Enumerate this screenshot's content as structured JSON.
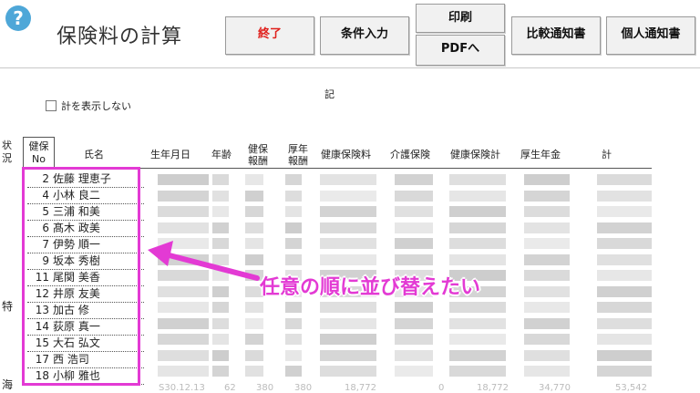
{
  "window": {
    "title": "保険料の計算",
    "help_icon": "question-circle-icon",
    "help_label": "?"
  },
  "toolbar": {
    "exit_label": "終了",
    "conditions_label": "条件入力",
    "print_label": "印刷",
    "pdf_label": "PDFへ",
    "compare_notice_label": "比較通知書",
    "personal_notice_label": "個人通知書"
  },
  "section": {
    "mark": "記"
  },
  "options": {
    "hide_total_label": "計を表示しない"
  },
  "table": {
    "status_header": [
      "状",
      "況"
    ],
    "no_header": [
      "健保",
      "No"
    ],
    "columns": {
      "name": "氏名",
      "birth": "生年月日",
      "age": "年齢",
      "health_pay": [
        "健保",
        "報酬"
      ],
      "pension_pay": [
        "厚年",
        "報酬"
      ],
      "health_ins": "健康保険料",
      "care_ins": "介護保険",
      "health_total": "健康保険計",
      "pension": "厚生年金",
      "total": "計"
    },
    "rows": [
      {
        "no": "2",
        "name": "佐藤 理恵子"
      },
      {
        "no": "4",
        "name": "小林 良二"
      },
      {
        "no": "5",
        "name": "三浦 和美"
      },
      {
        "no": "6",
        "name": "髙木 政美"
      },
      {
        "no": "7",
        "name": "伊勢 順一"
      },
      {
        "no": "9",
        "name": "坂本 秀樹"
      },
      {
        "no": "11",
        "name": "尾関 美香"
      },
      {
        "no": "12",
        "name": "井原 友美"
      },
      {
        "no": "13",
        "name": "加古 修"
      },
      {
        "no": "14",
        "name": "荻原 真一"
      },
      {
        "no": "15",
        "name": "大石 弘文"
      },
      {
        "no": "17",
        "name": "西 浩司"
      },
      {
        "no": "18",
        "name": "小柳 雅也"
      }
    ],
    "status_marks": {
      "special": "特",
      "partial": "海"
    },
    "footer_values": [
      "S30.12.13",
      "62",
      "380",
      "380",
      "18,772",
      "0",
      "18,772",
      "34,770",
      "53,542"
    ]
  },
  "annotation": {
    "text": "任意の順に並び替えたい",
    "color": "#e33ad4"
  }
}
